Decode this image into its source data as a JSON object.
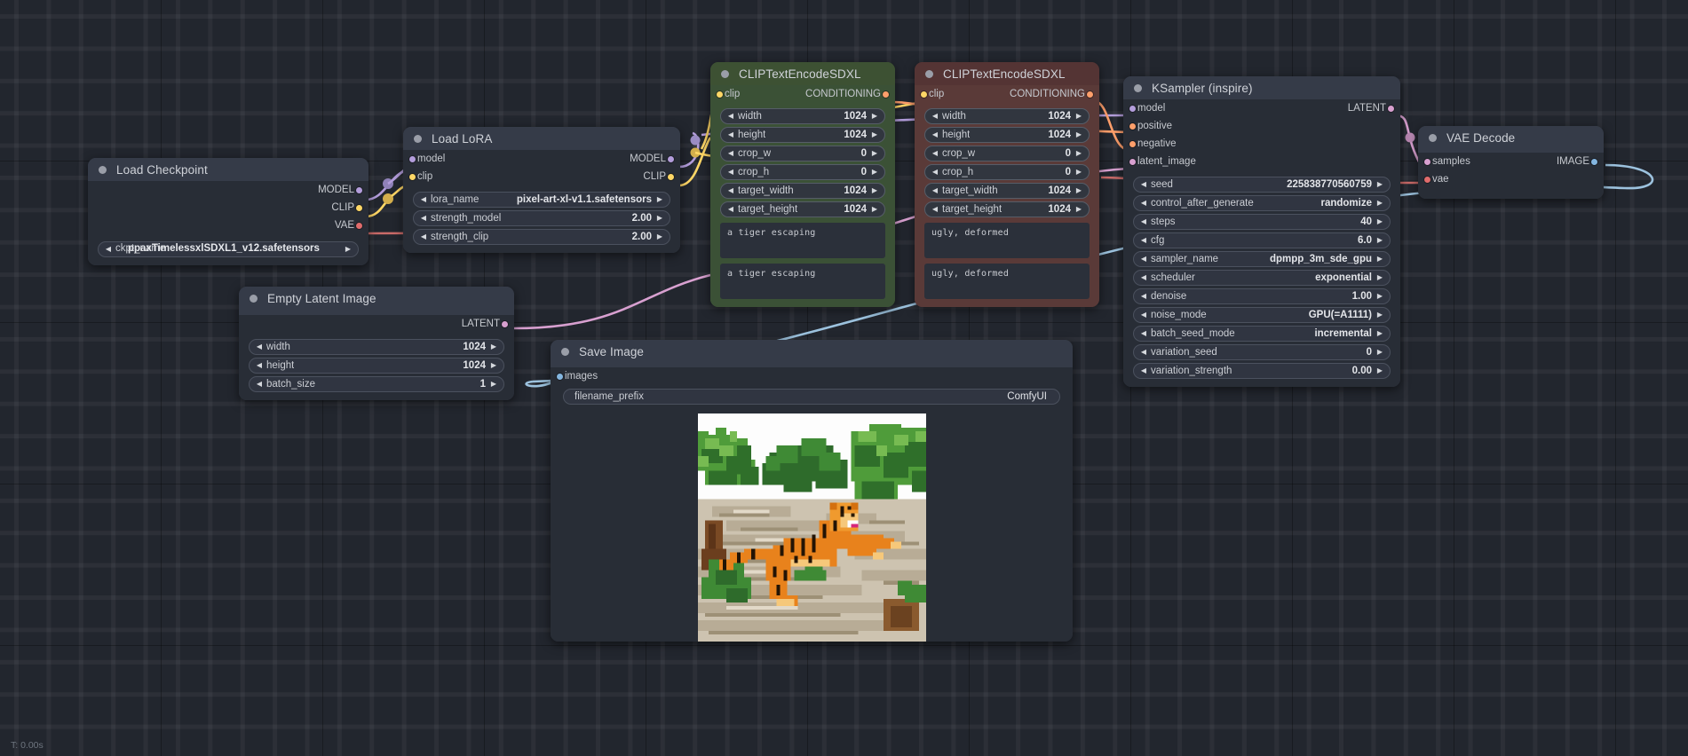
{
  "app": {
    "status_text": "T: 0.00s"
  },
  "colors": {
    "model": "#b39ddb",
    "clip": "#ffd766",
    "vae": "#e06c6c",
    "conditioning": "#ff9f6b",
    "latent": "#d8a0d0",
    "image": "#84b6e0",
    "node_header": "#353b48",
    "node_body": "#282d36",
    "positive_node": "#3d5133",
    "negative_node": "#543434"
  },
  "nodes": [
    {
      "id": "load-checkpoint",
      "title": "Load Checkpoint",
      "outputs": [
        {
          "label": "MODEL",
          "color": "#b39ddb"
        },
        {
          "label": "CLIP",
          "color": "#ffd766"
        },
        {
          "label": "VAE",
          "color": "#e06c6c"
        }
      ],
      "widgets": [
        {
          "name": "ckpt_name",
          "value": "ppaxTimelessxlSDXL1_v12.safetensors",
          "overlapping": true
        }
      ]
    },
    {
      "id": "load-lora",
      "title": "Load LoRA",
      "inputs": [
        {
          "label": "model",
          "color": "#b39ddb"
        },
        {
          "label": "clip",
          "color": "#ffd766"
        }
      ],
      "outputs": [
        {
          "label": "MODEL",
          "color": "#b39ddb"
        },
        {
          "label": "CLIP",
          "color": "#ffd766"
        }
      ],
      "widgets": [
        {
          "name": "lora_name",
          "value": "pixel-art-xl-v1.1.safetensors"
        },
        {
          "name": "strength_model",
          "value": "2.00"
        },
        {
          "name": "strength_clip",
          "value": "2.00"
        }
      ]
    },
    {
      "id": "clip-text-encode-positive",
      "title": "CLIPTextEncodeSDXL",
      "theme": "green",
      "inputs": [
        {
          "label": "clip",
          "color": "#ffd766"
        }
      ],
      "outputs": [
        {
          "label": "CONDITIONING",
          "color": "#ff9f6b"
        }
      ],
      "widgets": [
        {
          "name": "width",
          "value": "1024"
        },
        {
          "name": "height",
          "value": "1024"
        },
        {
          "name": "crop_w",
          "value": "0"
        },
        {
          "name": "crop_h",
          "value": "0"
        },
        {
          "name": "target_width",
          "value": "1024"
        },
        {
          "name": "target_height",
          "value": "1024"
        }
      ],
      "texts": [
        "a tiger escaping",
        "a tiger escaping"
      ]
    },
    {
      "id": "clip-text-encode-negative",
      "title": "CLIPTextEncodeSDXL",
      "theme": "red",
      "inputs": [
        {
          "label": "clip",
          "color": "#ffd766"
        }
      ],
      "outputs": [
        {
          "label": "CONDITIONING",
          "color": "#ff9f6b"
        }
      ],
      "widgets": [
        {
          "name": "width",
          "value": "1024"
        },
        {
          "name": "height",
          "value": "1024"
        },
        {
          "name": "crop_w",
          "value": "0"
        },
        {
          "name": "crop_h",
          "value": "0"
        },
        {
          "name": "target_width",
          "value": "1024"
        },
        {
          "name": "target_height",
          "value": "1024"
        }
      ],
      "texts": [
        "ugly, deformed",
        "ugly, deformed"
      ]
    },
    {
      "id": "ksampler-inspire",
      "title": "KSampler (inspire)",
      "inputs": [
        {
          "label": "model",
          "color": "#b39ddb"
        },
        {
          "label": "positive",
          "color": "#ff9f6b"
        },
        {
          "label": "negative",
          "color": "#ff9f6b"
        },
        {
          "label": "latent_image",
          "color": "#d8a0d0"
        }
      ],
      "outputs": [
        {
          "label": "LATENT",
          "color": "#d8a0d0"
        }
      ],
      "widgets": [
        {
          "name": "seed",
          "value": "225838770560759"
        },
        {
          "name": "control_after_generate",
          "value": "randomize"
        },
        {
          "name": "steps",
          "value": "40"
        },
        {
          "name": "cfg",
          "value": "6.0"
        },
        {
          "name": "sampler_name",
          "value": "dpmpp_3m_sde_gpu"
        },
        {
          "name": "scheduler",
          "value": "exponential"
        },
        {
          "name": "denoise",
          "value": "1.00"
        },
        {
          "name": "noise_mode",
          "value": "GPU(=A1111)"
        },
        {
          "name": "batch_seed_mode",
          "value": "incremental"
        },
        {
          "name": "variation_seed",
          "value": "0"
        },
        {
          "name": "variation_strength",
          "value": "0.00"
        }
      ]
    },
    {
      "id": "vae-decode",
      "title": "VAE Decode",
      "inputs": [
        {
          "label": "samples",
          "color": "#d8a0d0"
        },
        {
          "label": "vae",
          "color": "#e06c6c"
        }
      ],
      "outputs": [
        {
          "label": "IMAGE",
          "color": "#84b6e0"
        }
      ]
    },
    {
      "id": "empty-latent-image",
      "title": "Empty Latent Image",
      "outputs": [
        {
          "label": "LATENT",
          "color": "#d8a0d0"
        }
      ],
      "widgets": [
        {
          "name": "width",
          "value": "1024"
        },
        {
          "name": "height",
          "value": "1024"
        },
        {
          "name": "batch_size",
          "value": "1"
        }
      ]
    },
    {
      "id": "save-image",
      "title": "Save Image",
      "inputs": [
        {
          "label": "images",
          "color": "#84b6e0"
        }
      ],
      "widgets": [
        {
          "name": "filename_prefix",
          "value": "ComfyUI",
          "plain": true
        }
      ],
      "preview_alt": "pixel-art tiger leaping on stone steps surrounded by green foliage"
    }
  ]
}
